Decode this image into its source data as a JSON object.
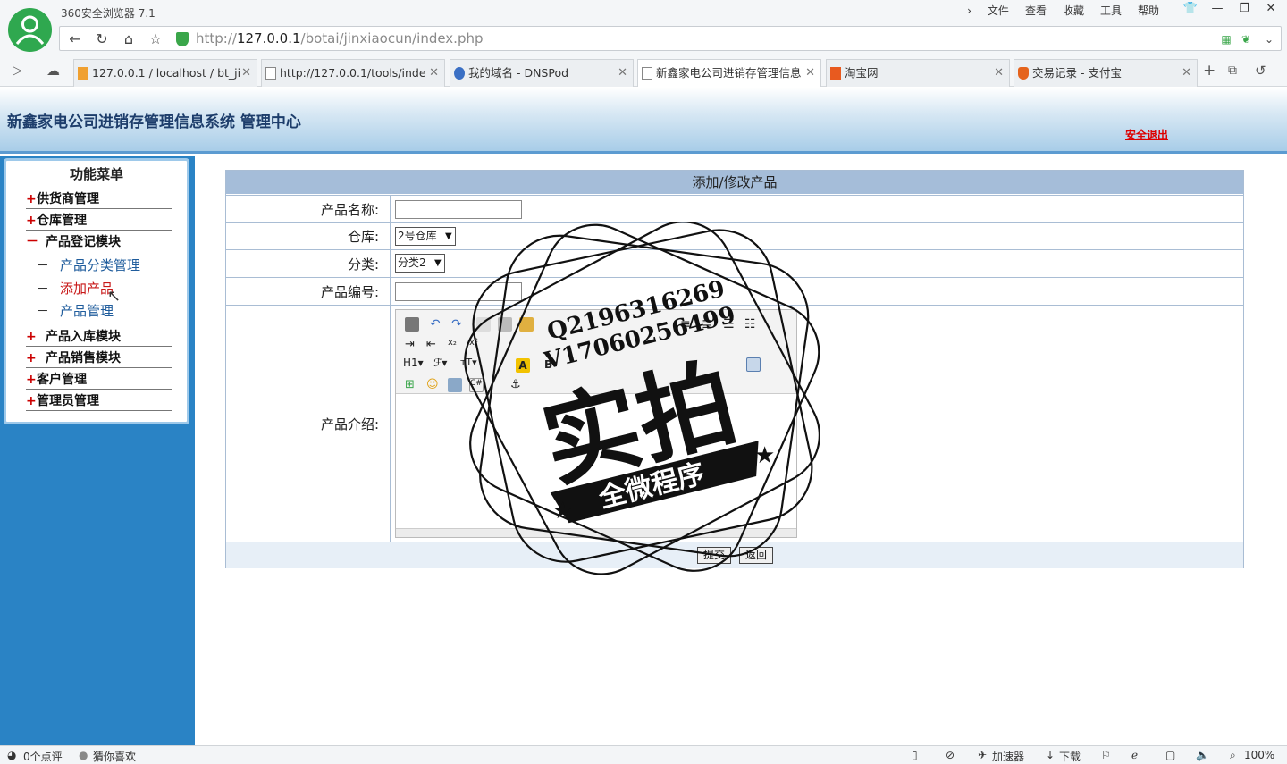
{
  "browser": {
    "title": "360安全浏览器 7.1",
    "menu": [
      "文件",
      "查看",
      "收藏",
      "工具",
      "帮助"
    ],
    "url_prefix": "http://",
    "url_host": "127.0.0.1",
    "url_path": "/botai/jinxiaocun/index.php",
    "tabs": [
      {
        "label": "127.0.0.1 / localhost / bt_ji"
      },
      {
        "label": "http://127.0.0.1/tools/inde"
      },
      {
        "label": "我的域名 - DNSPod"
      },
      {
        "label": "新鑫家电公司进销存管理信息"
      },
      {
        "label": "淘宝网"
      },
      {
        "label": "交易记录 - 支付宝"
      }
    ]
  },
  "app": {
    "title": "新鑫家电公司进销存管理信息系统 管理中心",
    "logout": "安全退出"
  },
  "sidebar": {
    "title": "功能菜单",
    "items": [
      {
        "sign": "+",
        "label": "供货商管理"
      },
      {
        "sign": "+",
        "label": "仓库管理"
      },
      {
        "sign": "－",
        "label": "产品登记模块"
      },
      {
        "sign": "+",
        "label": "产品入库模块"
      },
      {
        "sign": "+",
        "label": "产品销售模块"
      },
      {
        "sign": "+",
        "label": "客户管理"
      },
      {
        "sign": "+",
        "label": "管理员管理"
      }
    ],
    "subitems": [
      {
        "label": "产品分类管理"
      },
      {
        "label": "添加产品"
      },
      {
        "label": "产品管理"
      }
    ],
    "dash": "－"
  },
  "form": {
    "header": "添加/修改产品",
    "name_label": "产品名称:",
    "warehouse_label": "仓库:",
    "warehouse_value": "2号仓库",
    "category_label": "分类:",
    "category_value": "分类2",
    "code_label": "产品编号:",
    "intro_label": "产品介绍:",
    "submit": "提交",
    "back": "返回"
  },
  "watermark": {
    "qq": "Q2196316269",
    "vx": "V17060256499",
    "main": "实拍",
    "banner": "全微程序"
  },
  "status": {
    "comments": "0个点评",
    "guess": "猜你喜欢",
    "accelerator": "加速器",
    "download": "下载",
    "zoom": "100%"
  }
}
